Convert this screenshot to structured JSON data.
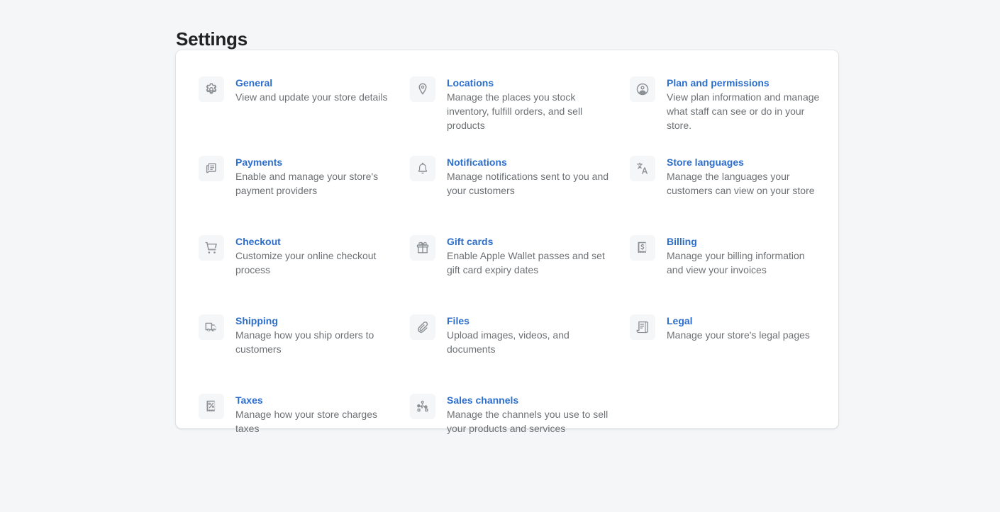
{
  "header": {
    "title": "Settings"
  },
  "colors": {
    "page_background": "#f4f6f8",
    "card_background": "#ffffff",
    "link": "#2c6ecb",
    "body_text": "#6d7175",
    "title_text": "#202223",
    "icon": "#8c9196",
    "icon_tile_background": "#f4f6f8"
  },
  "settings": {
    "columns": [
      {
        "items": [
          {
            "icon": "gear-icon",
            "title": "General",
            "description": "View and update your store details"
          },
          {
            "icon": "payments-icon",
            "title": "Payments",
            "description": "Enable and manage your store's payment providers"
          },
          {
            "icon": "cart-icon",
            "title": "Checkout",
            "description": "Customize your online checkout process"
          },
          {
            "icon": "truck-icon",
            "title": "Shipping",
            "description": "Manage how you ship orders to customers"
          },
          {
            "icon": "receipt-percent-icon",
            "title": "Taxes",
            "description": "Manage how your store charges taxes"
          }
        ]
      },
      {
        "items": [
          {
            "icon": "location-pin-icon",
            "title": "Locations",
            "description": "Manage the places you stock inventory, fulfill orders, and sell products"
          },
          {
            "icon": "bell-icon",
            "title": "Notifications",
            "description": "Manage notifications sent to you and your customers"
          },
          {
            "icon": "gift-card-icon",
            "title": "Gift cards",
            "description": "Enable Apple Wallet passes and set gift card expiry dates"
          },
          {
            "icon": "paperclip-icon",
            "title": "Files",
            "description": "Upload images, videos, and documents"
          },
          {
            "icon": "sales-channels-icon",
            "title": "Sales channels",
            "description": "Manage the channels you use to sell your products and services"
          }
        ]
      },
      {
        "items": [
          {
            "icon": "person-circle-icon",
            "title": "Plan and permissions",
            "description": "View plan information and manage what staff can see or do in your store."
          },
          {
            "icon": "translate-icon",
            "title": "Store languages",
            "description": "Manage the languages your customers can view on your store"
          },
          {
            "icon": "receipt-dollar-icon",
            "title": "Billing",
            "description": "Manage your billing information and view your invoices"
          },
          {
            "icon": "legal-document-icon",
            "title": "Legal",
            "description": "Manage your store's legal pages"
          }
        ]
      }
    ]
  }
}
